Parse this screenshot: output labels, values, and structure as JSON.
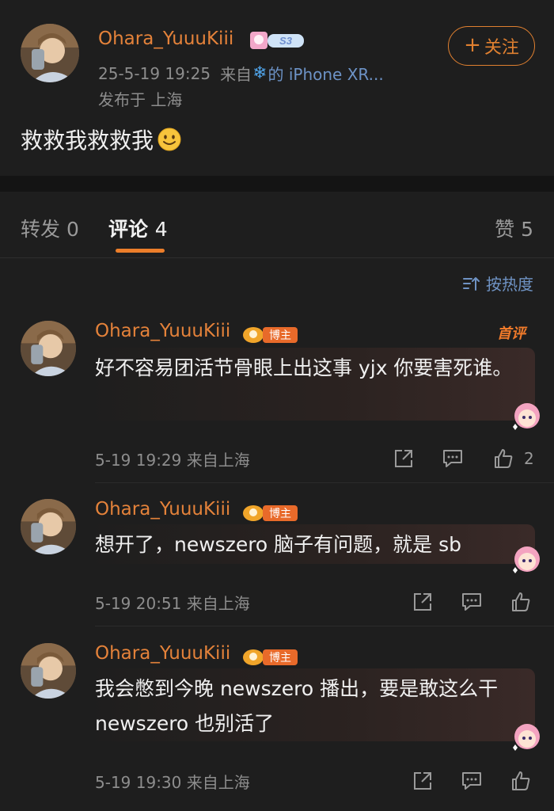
{
  "post": {
    "username": "Ohara_YuuuKiii",
    "vip_level": "S3",
    "time": "25-5-19 19:25",
    "source_prefix": "来自",
    "source_device": "的 iPhone XR...",
    "location": "发布于 上海",
    "text": "救救我救救我",
    "follow_label": "关注",
    "follow_plus": "+"
  },
  "tabs": {
    "repost_label": "转发",
    "repost_count": "0",
    "comment_label": "评论",
    "comment_count": "4",
    "like_label": "赞",
    "like_count": "5"
  },
  "sort_label": "按热度",
  "first_comment_badge": "首评",
  "blogger_badge": "博主",
  "comments": [
    {
      "username": "Ohara_YuuuKiii",
      "text": "好不容易团活节骨眼上出这事 yjx 你要害死谁。",
      "time": "5-19 19:29 来自上海",
      "likes": "2"
    },
    {
      "username": "Ohara_YuuuKiii",
      "text": "想开了，newszero 脑子有问题，就是 sb",
      "time": "5-19 20:51 来自上海",
      "likes": ""
    },
    {
      "username": "Ohara_YuuuKiii",
      "text": "我会憋到今晚 newszero 播出，要是敢这么干 newszero 也别活了",
      "time": "5-19 19:30 来自上海",
      "likes": ""
    }
  ],
  "colors": {
    "background": "#1e1e1e",
    "username": "#e4823a",
    "accent": "#ec7e2a",
    "link": "#6f93c4",
    "muted": "#8d8d8d"
  }
}
